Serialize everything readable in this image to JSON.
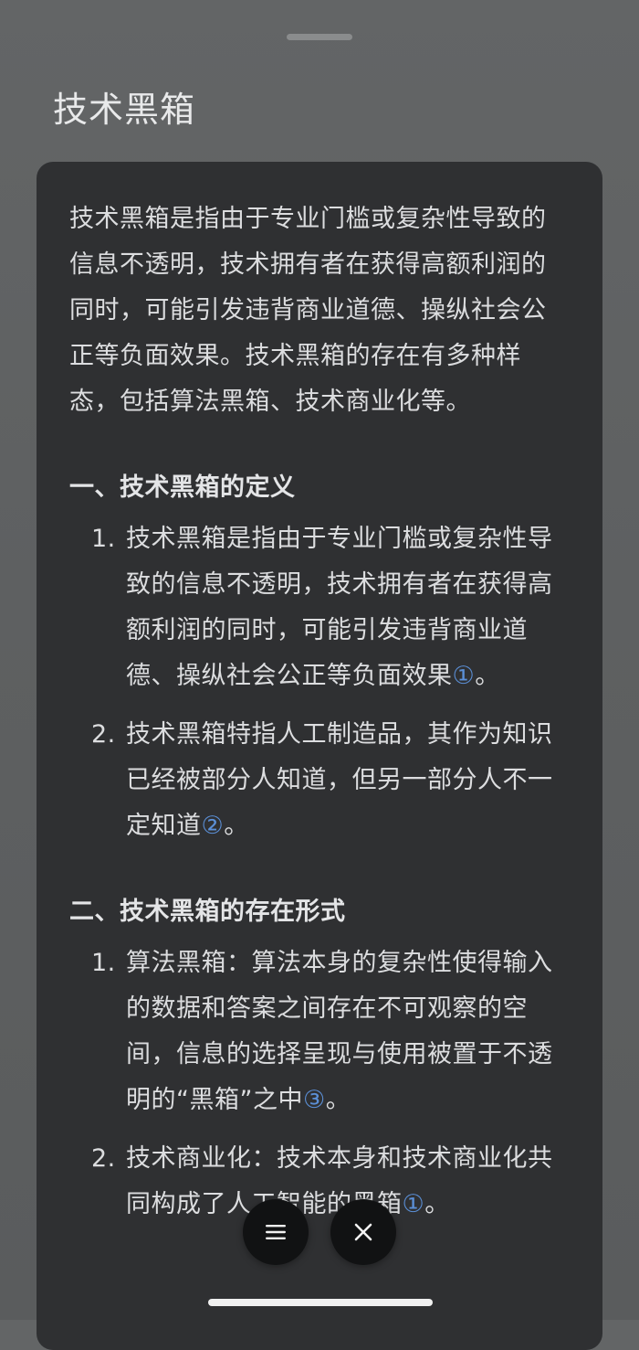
{
  "sheet": {
    "title": "技术黑箱"
  },
  "content": {
    "intro": "技术黑箱是指由于专业门槛或复杂性导致的信息不透明，技术拥有者在获得高额利润的同时，可能引发违背商业道德、操纵社会公正等负面效果。技术黑箱的存在有多种样态，包括算法黑箱、技术商业化等。",
    "sections": [
      {
        "heading": "一、技术黑箱的定义",
        "items": [
          {
            "number": "1.",
            "text": "技术黑箱是指由于专业门槛或复杂性导致的信息不透明，技术拥有者在获得高额利润的同时，可能引发违背商业道德、操纵社会公正等负面效果",
            "citation": "①",
            "end": "。"
          },
          {
            "number": "2.",
            "text": "技术黑箱特指人工制造品，其作为知识已经被部分人知道，但另一部分人不一定知道",
            "citation": "②",
            "end": "。"
          }
        ]
      },
      {
        "heading": "二、技术黑箱的存在形式",
        "items": [
          {
            "number": "1.",
            "text": "算法黑箱：算法本身的复杂性使得输入的数据和答案之间存在不可观察的空间，信息的选择呈现与使用被置于不透明的“黑箱”之中",
            "citation": "③",
            "end": "。"
          },
          {
            "number": "2.",
            "text": "技术商业化：技术本身和技术商业化共同构成了人工智能的黑箱",
            "citation": "①",
            "end": "。"
          }
        ]
      }
    ]
  },
  "controls": {
    "menu_icon": "menu-icon",
    "close_icon": "close-icon"
  },
  "colors": {
    "citation": "#5b8fd6",
    "card_background": "#2f3032",
    "backdrop": "#606263"
  }
}
